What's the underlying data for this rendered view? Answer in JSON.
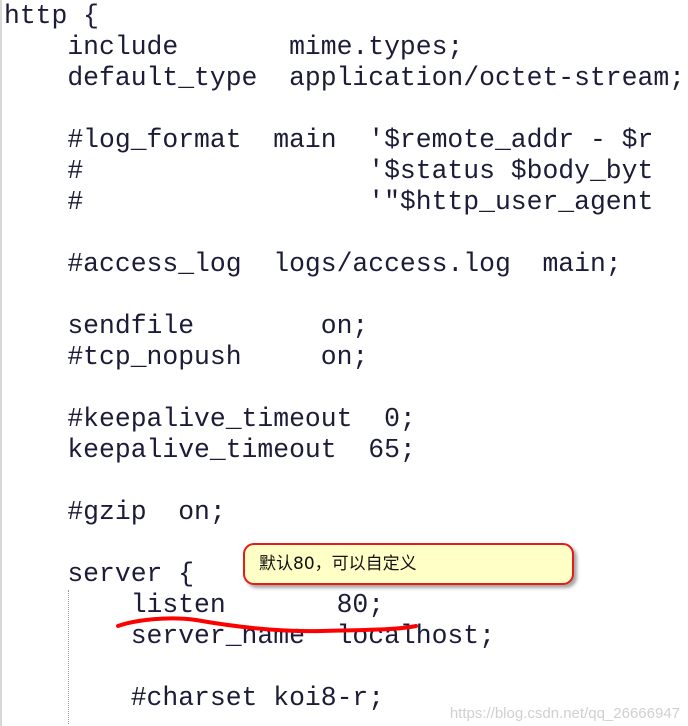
{
  "code_lines": [
    "http {",
    "    include       mime.types;",
    "    default_type  application/octet-stream;",
    "",
    "    #log_format  main  '$remote_addr - $r",
    "    #                  '$status $body_byt",
    "    #                  '\"$http_user_agent",
    "",
    "    #access_log  logs/access.log  main;",
    "",
    "    sendfile        on;",
    "    #tcp_nopush     on;",
    "",
    "    #keepalive_timeout  0;",
    "    keepalive_timeout  65;",
    "",
    "    #gzip  on;",
    "",
    "    server {",
    "        listen       80;",
    "        server_name  localhost;",
    "",
    "        #charset koi8-r;"
  ],
  "annotation": {
    "text": "默认80，可以自定义",
    "border_color": "#e51c1c",
    "fill_color": "#ffffc6"
  },
  "highlight_color": "#ff0000",
  "watermark": "https://blog.csdn.net/qq_26666947"
}
